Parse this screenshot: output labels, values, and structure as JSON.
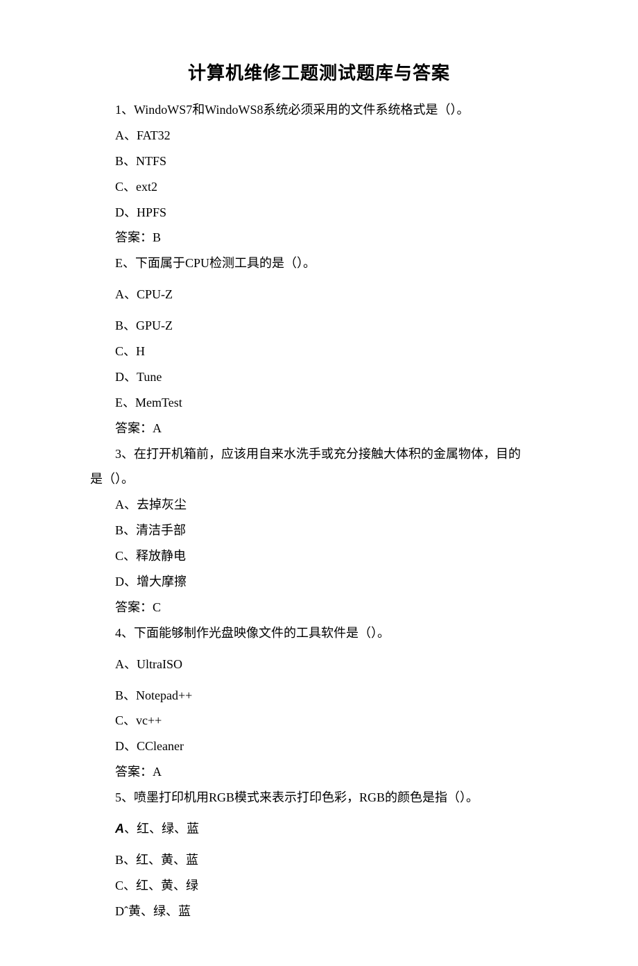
{
  "title": "计算机维修工题测试题库与答案",
  "q1": {
    "stem": "1、WindoWS7和WindoWS8系统必须采用的文件系统格式是（）。",
    "a": "A、FAT32",
    "b": "B、NTFS",
    "c": "C、ext2",
    "d": "D、HPFS",
    "answer": "答案：B"
  },
  "q2": {
    "stem": "E、下面属于CPU检测工具的是（）。",
    "a": "A、CPU-Z",
    "b": "B、GPU-Z",
    "c": "C、H",
    "d": "D、Tune",
    "e": "E、MemTest",
    "answer": "答案：A"
  },
  "q3": {
    "stem_line1": "3、在打开机箱前，应该用自来水洗手或充分接触大体积的金属物体，目的",
    "stem_line2": "是（）。",
    "a": "A、去掉灰尘",
    "b": "B、清洁手部",
    "c": "C、释放静电",
    "d": "D、增大摩擦",
    "answer": "答案：C"
  },
  "q4": {
    "stem": "4、下面能够制作光盘映像文件的工具软件是（）。",
    "a": "A、UltraISO",
    "b": "B、Notepad++",
    "c": "C、vc++",
    "d": "D、CCleaner",
    "answer": "答案：A"
  },
  "q5": {
    "stem": "5、喷墨打印机用RGB模式来表示打印色彩，RGB的颜色是指（）。",
    "a_prefix": "A",
    "a_rest": "、红、绿、蓝",
    "b": "B、红、黄、蓝",
    "c": "C、红、黄、绿",
    "d": "Dˆ黄、绿、蓝"
  }
}
